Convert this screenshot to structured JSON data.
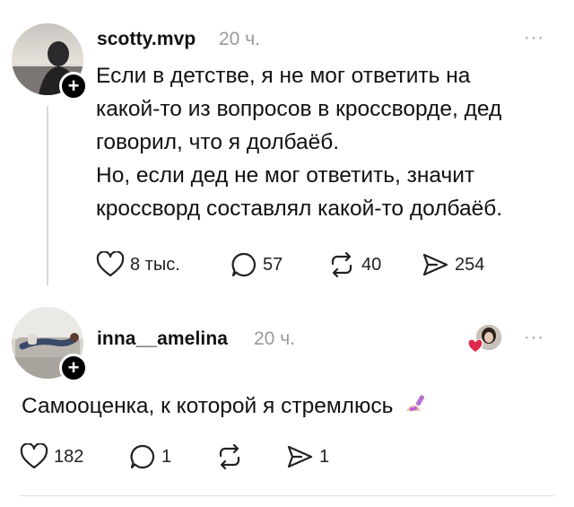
{
  "posts": [
    {
      "username": "scotty.mvp",
      "time": "20 ч.",
      "more": "···",
      "lines": [
        "Если в детстве, я не мог ответить на",
        "какой-то из вопросов в кроссворде, дед",
        "говорил, что я долбаёб.",
        "Но, если дед не мог ответить, значит",
        "кроссворд составлял какой-то долбаёб."
      ],
      "likes": "8 тыс.",
      "comments": "57",
      "reposts": "40",
      "shares": "254"
    },
    {
      "username": "inna__amelina",
      "time": "20 ч.",
      "more": "···",
      "text": "Самооценка, к которой я стремлюсь",
      "likes": "182",
      "comments": "1",
      "reposts": "",
      "shares": "1"
    }
  ],
  "icons": {
    "heart": "heart-icon",
    "comment": "comment-icon",
    "repost": "repost-icon",
    "share": "share-icon",
    "plus": "follow-plus-icon",
    "nail": "nail-polish-emoji"
  },
  "colors": {
    "text": "#111111",
    "muted": "#9a9a9a",
    "liked_heart": "#e0284a"
  }
}
